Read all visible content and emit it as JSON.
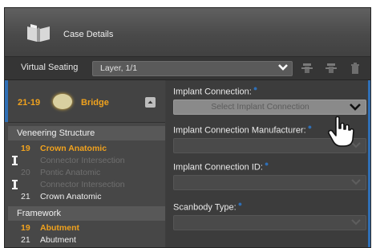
{
  "header": {
    "title": "Case Details",
    "logo_icon": "book-icon"
  },
  "seating": {
    "label": "Virtual Seating",
    "value": "Layer, 1/1",
    "tools": [
      "tooth-add-icon",
      "tooth-remove-icon",
      "trash-icon"
    ]
  },
  "tooth": {
    "number": "21-19",
    "type": "Bridge"
  },
  "veneering": {
    "title": "Veneering Structure",
    "items": [
      {
        "num": "19",
        "label": "Crown Anatomic"
      },
      {
        "num": "",
        "label": "Connector Intersection"
      },
      {
        "num": "20",
        "label": "Pontic Anatomic"
      },
      {
        "num": "",
        "label": "Connector Intersection"
      },
      {
        "num": "21",
        "label": "Crown Anatomic"
      }
    ]
  },
  "framework": {
    "title": "Framework",
    "items": [
      {
        "num": "19",
        "label": "Abutment"
      },
      {
        "num": "21",
        "label": "Abutment"
      }
    ]
  },
  "fields": {
    "implant_connection": {
      "label": "Implant Connection:",
      "placeholder": "Select Implant Connection"
    },
    "manufacturer": {
      "label": "Implant Connection Manufacturer:"
    },
    "connection_id": {
      "label": "Implant Connection ID:"
    },
    "scanbody": {
      "label": "Scanbody Type:"
    }
  },
  "colors": {
    "accent": "#f0a21e",
    "selection": "#2f6fb6",
    "panel": "#3e3e3e"
  }
}
